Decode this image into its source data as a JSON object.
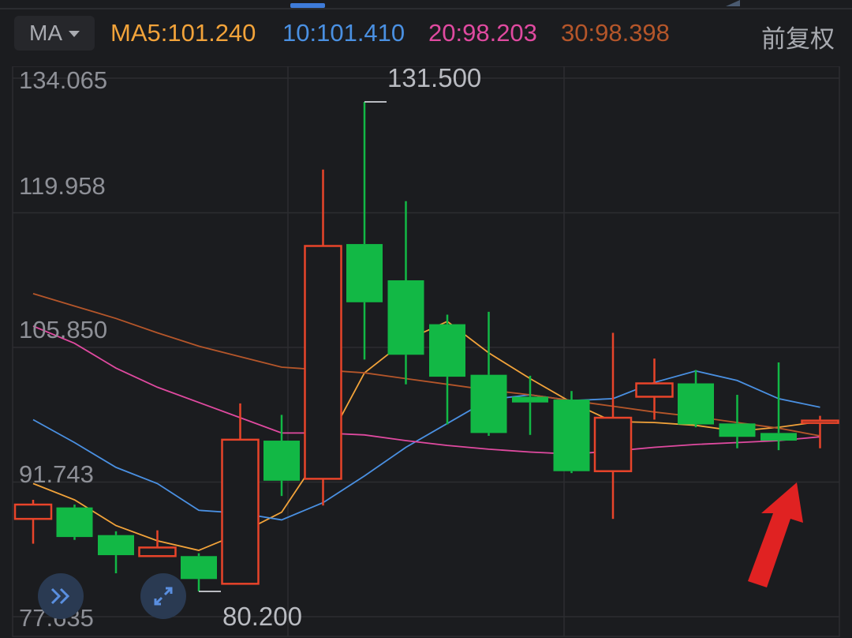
{
  "toolbar": {
    "indicator": "MA",
    "ma_values": [
      {
        "label": "MA5:101.240",
        "color": "#f2a33a"
      },
      {
        "label": "10:101.410",
        "color": "#4a90e2"
      },
      {
        "label": "20:98.203",
        "color": "#e04aa0"
      },
      {
        "label": "30:98.398",
        "color": "#b5562a"
      }
    ],
    "adjust_label": "前复权"
  },
  "axis": {
    "price_labels": [
      "134.065",
      "119.958",
      "105.850",
      "91.743",
      "77.635"
    ]
  },
  "annotations": {
    "high": "131.500",
    "low": "80.200"
  },
  "icons": {
    "expand": "double-chevron-right-icon",
    "fullscreen": "fullscreen-icon",
    "arrow": "red-arrow-icon"
  },
  "colors": {
    "up": "#e8442a",
    "down": "#12b845",
    "ma5": "#f2a33a",
    "ma10": "#4a90e2",
    "ma20": "#e04aa0",
    "ma30": "#b5562a"
  },
  "chart_data": {
    "type": "candlestick",
    "ylim": [
      77.635,
      134.065
    ],
    "ticks": [
      134.065,
      119.958,
      105.85,
      91.743,
      77.635
    ],
    "candles": [
      {
        "o": 87.8,
        "c": 89.3,
        "h": 89.8,
        "l": 85.2
      },
      {
        "o": 89.0,
        "c": 85.9,
        "h": 89.3,
        "l": 85.6
      },
      {
        "o": 86.1,
        "c": 84.0,
        "h": 86.5,
        "l": 82.1
      },
      {
        "o": 83.9,
        "c": 84.8,
        "h": 86.6,
        "l": 83.9
      },
      {
        "o": 83.9,
        "c": 81.5,
        "h": 84.2,
        "l": 80.2
      },
      {
        "o": 81.0,
        "c": 96.1,
        "h": 99.9,
        "l": 81.0
      },
      {
        "o": 96.0,
        "c": 91.8,
        "h": 98.7,
        "l": 90.2
      },
      {
        "o": 92.0,
        "c": 116.4,
        "h": 124.4,
        "l": 89.2
      },
      {
        "o": 116.6,
        "c": 110.5,
        "h": 131.5,
        "l": 104.5
      },
      {
        "o": 112.8,
        "c": 105.0,
        "h": 121.1,
        "l": 101.9
      },
      {
        "o": 108.2,
        "c": 102.7,
        "h": 109.2,
        "l": 97.7
      },
      {
        "o": 102.9,
        "c": 96.8,
        "h": 109.5,
        "l": 96.5
      },
      {
        "o": 100.6,
        "c": 100.0,
        "h": 102.8,
        "l": 96.6
      },
      {
        "o": 100.3,
        "c": 92.8,
        "h": 101.2,
        "l": 92.6
      },
      {
        "o": 92.8,
        "c": 98.4,
        "h": 107.3,
        "l": 87.8
      },
      {
        "o": 100.6,
        "c": 102.0,
        "h": 104.6,
        "l": 98.2
      },
      {
        "o": 102.0,
        "c": 97.7,
        "h": 103.4,
        "l": 97.4
      },
      {
        "o": 97.8,
        "c": 96.4,
        "h": 100.8,
        "l": 95.2
      },
      {
        "o": 96.8,
        "c": 96.0,
        "h": 104.2,
        "l": 95.0
      },
      {
        "o": 98.0,
        "c": 98.1,
        "h": 98.6,
        "l": 95.2
      }
    ],
    "series": [
      {
        "name": "MA5",
        "values": [
          91.5,
          89.8,
          87.1,
          85.5,
          84.5,
          86.3,
          88.5,
          95.0,
          103.1,
          106.5,
          108.5,
          105.2,
          102.5,
          100.0,
          98.0,
          97.9,
          97.6,
          97.0,
          97.4,
          98.0
        ]
      },
      {
        "name": "10",
        "values": [
          98.2,
          95.8,
          93.2,
          91.5,
          88.7,
          88.4,
          87.7,
          89.5,
          92.3,
          95.3,
          97.8,
          100.3,
          100.8,
          100.2,
          100.4,
          102.1,
          103.3,
          102.3,
          100.4,
          99.5
        ]
      },
      {
        "name": "20",
        "values": [
          108.0,
          106.2,
          103.6,
          101.6,
          100.0,
          98.4,
          96.8,
          96.8,
          96.6,
          96.0,
          95.5,
          95.1,
          94.8,
          94.6,
          94.9,
          95.3,
          95.6,
          95.8,
          96.0,
          96.4
        ]
      },
      {
        "name": "30",
        "values": [
          111.4,
          110.1,
          108.8,
          107.3,
          105.9,
          104.8,
          103.7,
          103.4,
          103.1,
          102.5,
          101.9,
          101.3,
          100.8,
          100.2,
          99.6,
          99.0,
          98.5,
          97.9,
          97.3,
          96.5
        ]
      }
    ]
  }
}
